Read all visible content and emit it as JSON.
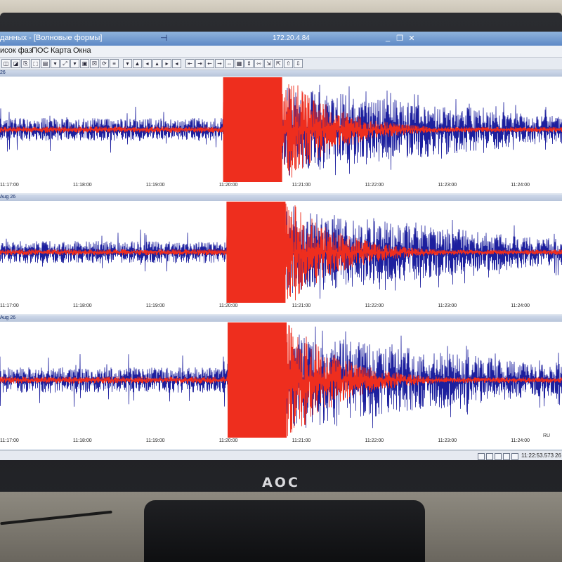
{
  "window": {
    "title": "данных - [Волновые формы]",
    "remote_host": "172.20.4.84",
    "pin_icon": "pin-icon",
    "minimize_glyph": "_",
    "restore_glyph": "❐",
    "close_glyph": "✕"
  },
  "menu": [
    "исок фаз",
    "ПОС",
    "Карта",
    "Окна"
  ],
  "colors": {
    "trace_vertical": "#1c1f9e",
    "trace_horizontal": "#ee2e1e",
    "panel_header": "#c6d2e6",
    "titlebar": "#6f97cf"
  },
  "panels": [
    {
      "label": "26",
      "seed": 11,
      "onset_fraction": 0.397,
      "time_labels": [
        "11:17:00",
        "11:18:00",
        "11:19:00",
        "11:20:00",
        "11:21:00",
        "11:22:00",
        "11:23:00",
        "11:24:00"
      ]
    },
    {
      "label": "Aug 26",
      "seed": 23,
      "onset_fraction": 0.403,
      "time_labels": [
        "11:17:00",
        "11:18:00",
        "11:19:00",
        "11:20:00",
        "11:21:00",
        "11:22:00",
        "11:23:00",
        "11:24:00"
      ]
    },
    {
      "label": "Aug 26",
      "seed": 37,
      "onset_fraction": 0.405,
      "time_labels": [
        "11:17:00",
        "11:18:00",
        "11:19:00",
        "11:20:00",
        "11:21:00",
        "11:22:00",
        "11:23:00",
        "11:24:00"
      ]
    }
  ],
  "status": {
    "clock": "11:22:53.573",
    "date": "26",
    "language": "RU"
  },
  "brand": "AOC"
}
